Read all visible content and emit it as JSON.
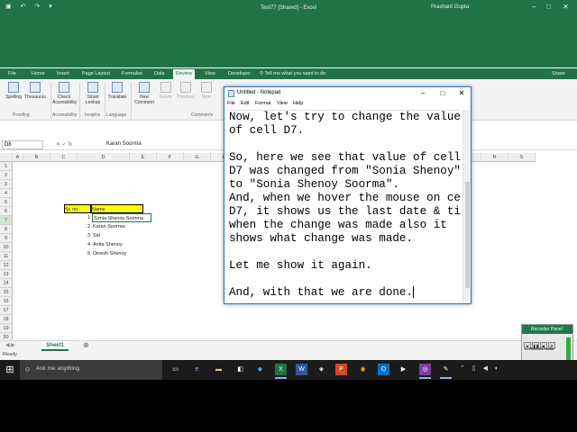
{
  "excel": {
    "window_title": "Test77 [Shared] - Excel",
    "user": "Prashant Gupta",
    "ribbon_tabs": [
      "File",
      "Home",
      "Insert",
      "Page Layout",
      "Formulas",
      "Data",
      "Review",
      "View",
      "Developer"
    ],
    "active_tab": "Review",
    "tell_me": "Tell me what you want to do",
    "share": "Share",
    "ribbon_buttons": [
      "Spelling",
      "Thesaurus",
      "Check Accessibility",
      "Smart Lookup",
      "Translate",
      "New Comment",
      "Delete",
      "Previous",
      "Next"
    ],
    "ribbon_groups": [
      "Proofing",
      "Accessibility",
      "Insights",
      "Language",
      "Comments"
    ],
    "name_box": "D8",
    "formula": "Karan Soorma",
    "columns": [
      "A",
      "B",
      "C",
      "D",
      "E",
      "F",
      "G",
      "H",
      "I",
      "J",
      "K",
      "L",
      "M",
      "N",
      "O",
      "P",
      "Q",
      "R",
      "S"
    ],
    "rows": [
      "1",
      "2",
      "3",
      "4",
      "5",
      "6",
      "7",
      "8",
      "9",
      "10",
      "11",
      "12",
      "13",
      "14",
      "15",
      "16",
      "17",
      "18",
      "19",
      "20",
      "21"
    ],
    "table": {
      "headers": [
        "Sr. no.",
        "Name"
      ],
      "entries": [
        {
          "sr": "1",
          "name": "Sonia Shenoy Soorma"
        },
        {
          "sr": "2",
          "name": "Karan Soorma"
        },
        {
          "sr": "3",
          "name": "Sid"
        },
        {
          "sr": "4",
          "name": "Anita Shenoy"
        },
        {
          "sr": "5",
          "name": "Dinesh Shenoy"
        }
      ]
    },
    "sheet_tab": "Sheet1",
    "status": "Ready"
  },
  "notepad": {
    "title": "Untitled - Notepad",
    "menu": [
      "File",
      "Edit",
      "Format",
      "View",
      "Help"
    ],
    "lines": [
      "Now, let's try to change the value",
      "of cell D7.",
      "",
      "So, here we see that value of cell",
      "D7 was changed from \"Sonia Shenoy\"",
      "to \"Sonia Shenoy Soorma\".",
      "And, when we hover the mouse on cell",
      "D7, it shows us the last date & time",
      "when the change was made also it",
      "shows what change was made.",
      "",
      "Let me show it again.",
      "",
      "And, with that we are done."
    ]
  },
  "recorder": {
    "title": "Recorder Panel",
    "record_audio": "Record Audio",
    "time": "00:03:19 | 688 KB"
  },
  "taskbar": {
    "search_placeholder": "Ask me anything"
  }
}
